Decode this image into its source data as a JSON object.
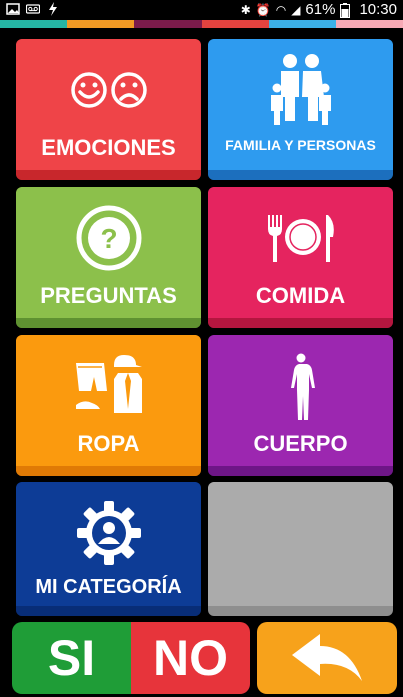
{
  "status_bar": {
    "battery": "61%",
    "time": "10:30",
    "stripe_colors": [
      "#25B6A4",
      "#F19A24",
      "#7B1B4B",
      "#E3433F",
      "#3CB0E6",
      "#F7A9B5"
    ]
  },
  "tiles": [
    {
      "label": "EMOCIONES",
      "icon": "emotions-faces-icon",
      "color": "#EF4448",
      "shade": "#C8272C"
    },
    {
      "label": "FAMILIA Y PERSONAS",
      "icon": "family-icon",
      "color": "#2E9BEF",
      "shade": "#1C6FBE"
    },
    {
      "label": "PREGUNTAS",
      "icon": "question-icon",
      "color": "#8CC04B",
      "shade": "#5F9231"
    },
    {
      "label": "COMIDA",
      "icon": "food-plate-icon",
      "color": "#E5245F",
      "shade": "#B4163F"
    },
    {
      "label": "ROPA",
      "icon": "clothes-icon",
      "color": "#FB9A0E",
      "shade": "#E07A05"
    },
    {
      "label": "CUERPO",
      "icon": "body-icon",
      "color": "#9C27B0",
      "shade": "#6E1687"
    },
    {
      "label": "MI CATEGORÍA",
      "icon": "gear-person-icon",
      "color": "#0D3C96",
      "shade": "#082D77"
    },
    {
      "label": "",
      "icon": "",
      "color": "#ABABAB",
      "shade": "#8E8E8E"
    }
  ],
  "bottom_bar": {
    "si_label": "SI",
    "no_label": "NO",
    "si_color": "#1F9D37",
    "no_color": "#E7343B",
    "back_icon": "back-arrow-icon",
    "back_color": "#F7A21B"
  }
}
